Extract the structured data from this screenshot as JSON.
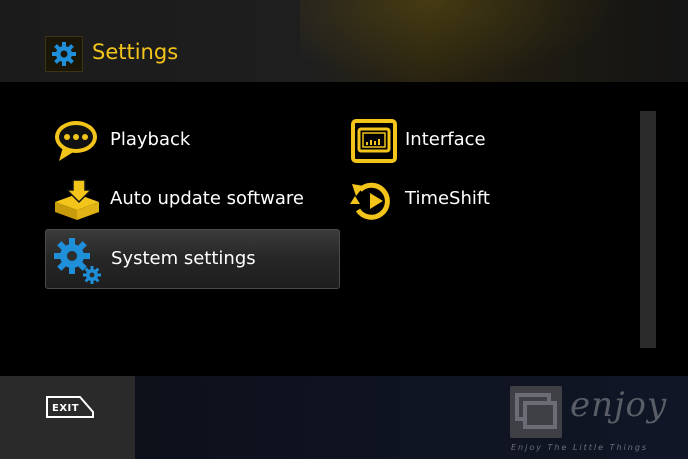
{
  "header": {
    "title": "Settings",
    "icon": "gear-icon"
  },
  "colors": {
    "accent": "#f3c41a",
    "icon_blue": "#1e8fd8"
  },
  "menu": {
    "items": [
      {
        "label": "Playback",
        "icon": "speech-bubble-icon",
        "selected": false
      },
      {
        "label": "Interface",
        "icon": "tv-screen-icon",
        "selected": false
      },
      {
        "label": "Auto update software",
        "icon": "download-box-icon",
        "selected": false
      },
      {
        "label": "TimeShift",
        "icon": "timeshift-icon",
        "selected": false
      },
      {
        "label": "System settings",
        "icon": "gears-icon",
        "selected": true
      }
    ]
  },
  "footer": {
    "exit_label": "EXIT",
    "logo_word": "enjoy",
    "logo_tagline": "Enjoy The Little Things"
  }
}
